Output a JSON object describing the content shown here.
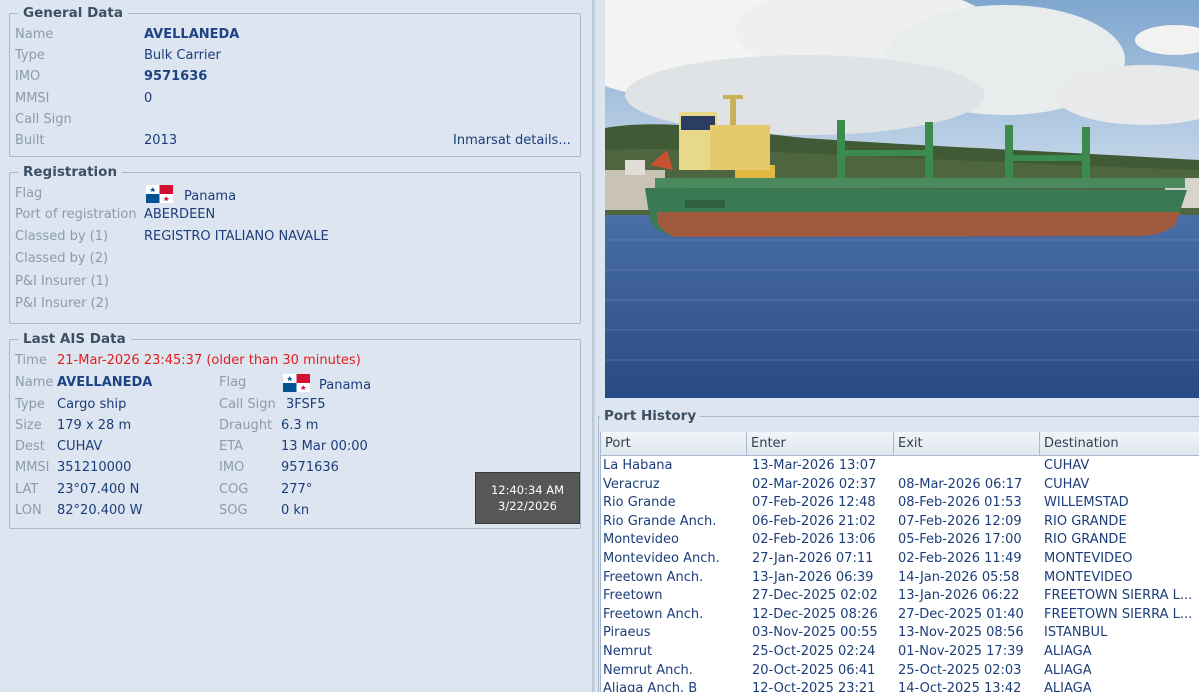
{
  "general": {
    "title": "General Data",
    "name_label": "Name",
    "name": "AVELLANEDA",
    "type_label": "Type",
    "type": "Bulk Carrier",
    "imo_label": "IMO",
    "imo": "9571636",
    "mmsi_label": "MMSI",
    "mmsi": "0",
    "callsign_label": "Call Sign",
    "callsign": "",
    "built_label": "Built",
    "built": "2013",
    "inmarsat_link": "Inmarsat details..."
  },
  "registration": {
    "title": "Registration",
    "flag_label": "Flag",
    "flag": "Panama",
    "port_label": "Port of registration",
    "port": "ABERDEEN",
    "class1_label": "Classed by (1)",
    "class1": "REGISTRO ITALIANO NAVALE",
    "class2_label": "Classed by (2)",
    "class2": "",
    "pi1_label": "P&I Insurer (1)",
    "pi1": "",
    "pi2_label": "P&I Insurer (2)",
    "pi2": ""
  },
  "ais": {
    "title": "Last AIS Data",
    "time_label": "Time",
    "time": "21-Mar-2026 23:45:37 (older than 30 minutes)",
    "name_label": "Name",
    "name": "AVELLANEDA",
    "type_label": "Type",
    "type": "Cargo ship",
    "size_label": "Size",
    "size": "179 x 28 m",
    "dest_label": "Dest",
    "dest": "CUHAV",
    "mmsi_label": "MMSI",
    "mmsi": "351210000",
    "lat_label": "LAT",
    "lat": "23°07.400 N",
    "lon_label": "LON",
    "lon": "82°20.400 W",
    "flag_label": "Flag",
    "flag": "Panama",
    "callsign_label": "Call Sign",
    "callsign": "3FSF5",
    "draught_label": "Draught",
    "draught": "6.3 m",
    "eta_label": "ETA",
    "eta": "13 Mar 00:00",
    "imo_label": "IMO",
    "imo": "9571636",
    "cog_label": "COG",
    "cog": "277°",
    "sog_label": "SOG",
    "sog": "0 kn"
  },
  "clock": {
    "time": "12:40:34 AM",
    "date": "3/22/2026"
  },
  "port_history": {
    "title": "Port History",
    "columns": [
      "Port",
      "Enter",
      "Exit",
      "Destination"
    ],
    "rows": [
      [
        "La Habana",
        "13-Mar-2026 13:07",
        "",
        "CUHAV"
      ],
      [
        "Veracruz",
        "02-Mar-2026 02:37",
        "08-Mar-2026 06:17",
        "CUHAV"
      ],
      [
        "Rio Grande",
        "07-Feb-2026 12:48",
        "08-Feb-2026 01:53",
        "WILLEMSTAD"
      ],
      [
        "Rio Grande Anch.",
        "06-Feb-2026 21:02",
        "07-Feb-2026 12:09",
        "RIO GRANDE"
      ],
      [
        "Montevideo",
        "02-Feb-2026 13:06",
        "05-Feb-2026 17:00",
        "RIO GRANDE"
      ],
      [
        "Montevideo Anch.",
        "27-Jan-2026 07:11",
        "02-Feb-2026 11:49",
        "MONTEVIDEO"
      ],
      [
        "Freetown Anch.",
        "13-Jan-2026 06:39",
        "14-Jan-2026 05:58",
        "MONTEVIDEO"
      ],
      [
        "Freetown",
        "27-Dec-2025 02:02",
        "13-Jan-2026 06:22",
        "FREETOWN SIERRA L..."
      ],
      [
        "Freetown Anch.",
        "12-Dec-2025 08:26",
        "27-Dec-2025 01:40",
        "FREETOWN SIERRA L..."
      ],
      [
        "Piraeus",
        "03-Nov-2025 00:55",
        "13-Nov-2025 08:56",
        "ISTANBUL"
      ],
      [
        "Nemrut",
        "25-Oct-2025 02:24",
        "01-Nov-2025 17:39",
        "ALIAGA"
      ],
      [
        "Nemrut Anch.",
        "20-Oct-2025 06:41",
        "25-Oct-2025 02:03",
        "ALIAGA"
      ],
      [
        "Aliaga Anch. B",
        "12-Oct-2025 23:21",
        "14-Oct-2025 13:42",
        "ALIAGA"
      ]
    ]
  },
  "colors": {
    "background": "#dde6f0",
    "value_text": "#1c3d7a",
    "label_text": "#8b9bae",
    "warning": "#e21d1d"
  },
  "icons": [
    "panama-flag-icon"
  ]
}
